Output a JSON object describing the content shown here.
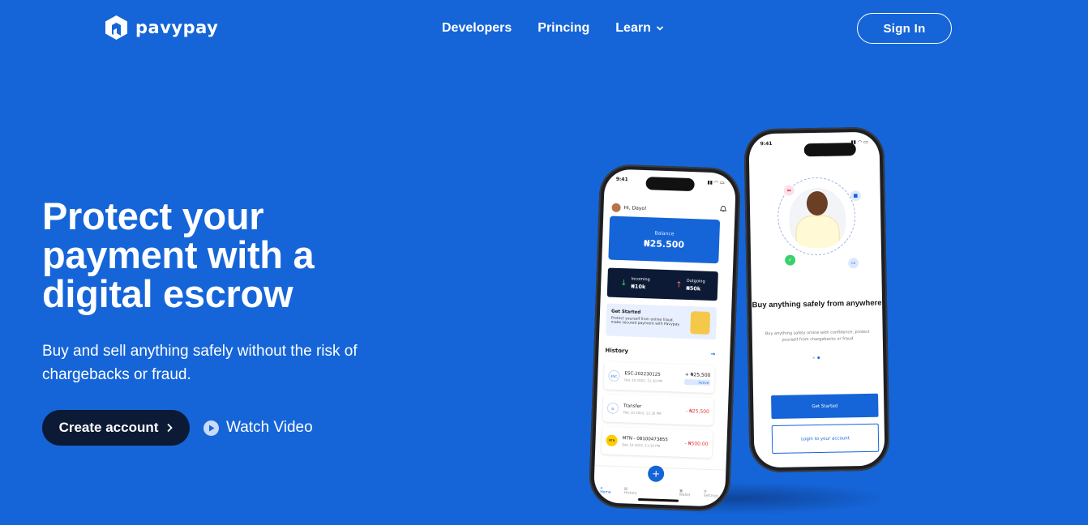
{
  "brand": {
    "name": "pavypay"
  },
  "nav": {
    "items": [
      {
        "label": "Developers"
      },
      {
        "label": "Princing"
      },
      {
        "label": "Learn"
      }
    ],
    "sign_in": "Sign In"
  },
  "hero": {
    "headline": "Protect your payment with a digital escrow",
    "subtext": "Buy and sell anything safely without the risk of chargebacks or fraud.",
    "create_account": "Create account",
    "watch_video": "Watch Video"
  },
  "colors": {
    "background": "#1565d8",
    "dark": "#0c1a35",
    "white": "#ffffff"
  },
  "phone_left": {
    "time": "9:41",
    "greeting": "Hi, Dayo!",
    "balance_label": "Balance",
    "balance_value": "₦25.500",
    "incoming_label": "Incoming",
    "incoming_value": "₦10k",
    "outgoing_label": "Outgoing",
    "outgoing_value": "₦50k",
    "get_started_title": "Get Started",
    "get_started_text": "Protect yourself from online fraud, make secured payment with Pavypay.",
    "history_label": "History",
    "transactions": [
      {
        "icon": "ESC",
        "title": "ESC-202230125",
        "date": "Dec 10 2022, 11:30 PM",
        "amount": "+ ₦25,500",
        "tag": "Active"
      },
      {
        "icon": "⇆",
        "title": "Transfer",
        "date": "Dec 10 2022, 11:30 PM",
        "amount": "- ₦25,500"
      },
      {
        "icon": "MTN",
        "title": "MTN - 08100473855",
        "date": "Dec 10 2022, 11:30 PM",
        "amount": "- ₦500.00"
      }
    ],
    "tabs": [
      "Home",
      "History",
      "Wallet",
      "Settings"
    ]
  },
  "phone_right": {
    "time": "9:41",
    "title": "Buy anything safely from anywhere",
    "subtitle": "Buy anything safely online with confidence, protect yourself from chargebacks or fraud",
    "get_started": "Get Started",
    "login": "Login to your account"
  }
}
